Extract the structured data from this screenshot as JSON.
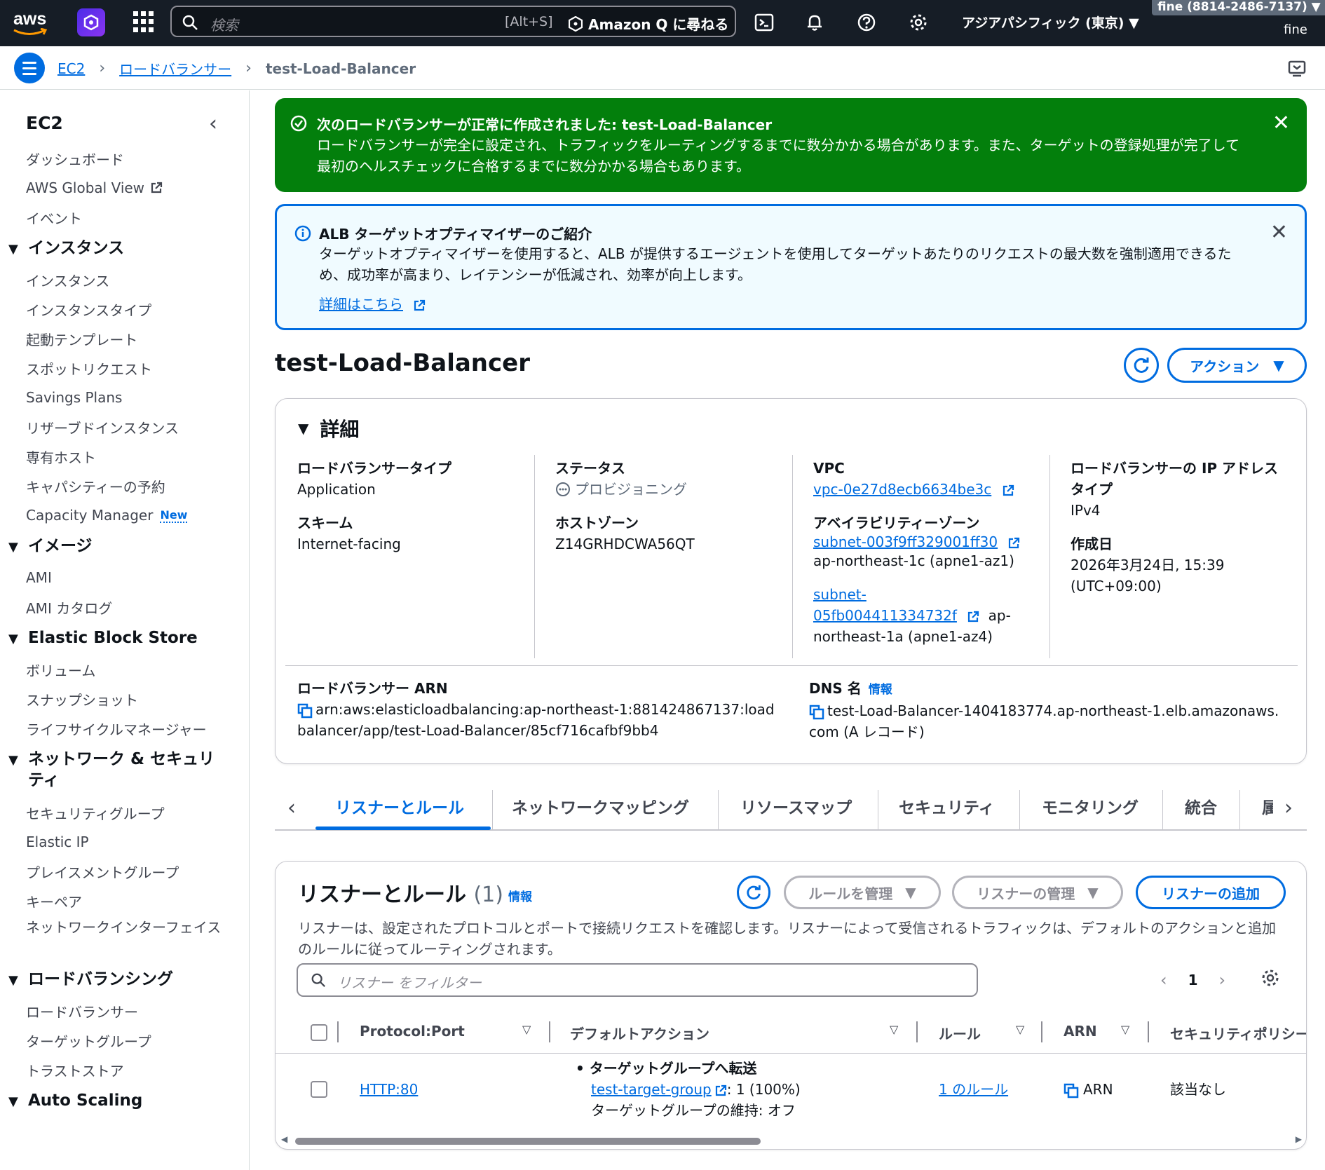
{
  "topnav": {
    "logo_text": "aws",
    "search_placeholder": "検索",
    "search_shortcut": "[Alt+S]",
    "amazon_q_label": "Amazon Q に尋ねる",
    "region": "アジアパシフィック (東京)",
    "account": "fine (8814-2486-7137)",
    "user": "fine"
  },
  "breadcrumb": {
    "items": [
      "EC2",
      "ロードバランサー"
    ],
    "current": "test-Load-Balancer"
  },
  "sidebar": {
    "title": "EC2",
    "top_items": [
      "ダッシュボード",
      "AWS Global View",
      "イベント"
    ],
    "sections": [
      {
        "title": "インスタンス",
        "items": [
          "インスタンス",
          "インスタンスタイプ",
          "起動テンプレート",
          "スポットリクエスト",
          "Savings Plans",
          "リザーブドインスタンス",
          "専有ホスト",
          "キャパシティーの予約",
          "Capacity Manager"
        ]
      },
      {
        "title": "イメージ",
        "items": [
          "AMI",
          "AMI カタログ"
        ]
      },
      {
        "title": "Elastic Block Store",
        "items": [
          "ボリューム",
          "スナップショット",
          "ライフサイクルマネージャー"
        ]
      },
      {
        "title": "ネットワーク & セキュリティ",
        "items": [
          "セキュリティグループ",
          "Elastic IP",
          "プレイスメントグループ",
          "キーペア",
          "ネットワークインターフェイス"
        ]
      },
      {
        "title": "ロードバランシング",
        "items": [
          "ロードバランサー",
          "ターゲットグループ",
          "トラストストア"
        ]
      },
      {
        "title": "Auto Scaling",
        "items": []
      }
    ],
    "new_badge": "New"
  },
  "flash_success": {
    "header": "次のロードバランサーが正常に作成されました: test-Load-Balancer",
    "body": "ロードバランサーが完全に設定され、トラフィックをルーティングするまでに数分かかる場合があります。また、ターゲットの登録処理が完了して最初のヘルスチェックに合格するまでに数分かかる場合もあります。"
  },
  "flash_info": {
    "header": "ALB ターゲットオプティマイザーのご紹介",
    "body": "ターゲットオプティマイザーを使用すると、ALB が提供するエージェントを使用してターゲットあたりのリクエストの最大数を強制適用できるため、成功率が高まり、レイテンシーが低減され、効率が向上します。",
    "link": "詳細はこちら"
  },
  "page": {
    "title": "test-Load-Balancer",
    "action_label": "アクション"
  },
  "details": {
    "section_title": "詳細",
    "lb_type_label": "ロードバランサータイプ",
    "lb_type_value": "Application",
    "scheme_label": "スキーム",
    "scheme_value": "Internet-facing",
    "status_label": "ステータス",
    "status_value": "プロビジョニング",
    "hosted_zone_label": "ホストゾーン",
    "hosted_zone_value": "Z14GRHDCWA56QT",
    "vpc_label": "VPC",
    "vpc_value": "vpc-0e27d8ecb6634be3c",
    "az_label": "アベイラビリティーゾーン",
    "az1_subnet": "subnet-003f9ff329001ff30",
    "az1_zone": "ap-northeast-1c (apne1-az1)",
    "az2_subnet_a": "subnet-",
    "az2_subnet_b": "05fb004411334732f",
    "az2_zone_a": "ap-",
    "az2_zone_b": "northeast-1a (apne1-az4)",
    "ip_type_label_1": "ロードバランサーの IP アドレス",
    "ip_type_label_2": "タイプ",
    "ip_type_value": "IPv4",
    "created_label": "作成日",
    "created_value_1": "2026年3月24日, 15:39",
    "created_value_2": "(UTC+09:00)",
    "arn_label": "ロードバランサー ARN",
    "arn_value": "arn:aws:elasticloadbalancing:ap-northeast-1:881424867137:loadbalancer/app/test-Load-Balancer/85cf716cafbf9bb4",
    "dns_label": "DNS 名",
    "dns_info": "情報",
    "dns_value": "test-Load-Balancer-1404183774.ap-northeast-1.elb.amazonaws.com (A レコード)"
  },
  "tabs": [
    "リスナーとルール",
    "ネットワークマッピング",
    "リソースマップ",
    "セキュリティ",
    "モニタリング",
    "統合",
    "属"
  ],
  "listeners": {
    "title": "リスナーとルール",
    "count": "(1)",
    "info": "情報",
    "manage_rules": "ルールを管理",
    "manage_listeners": "リスナーの管理",
    "add_listener": "リスナーの追加",
    "description": "リスナーは、設定されたプロトコルとポートで接続リクエストを確認します。リスナーによって受信されるトラフィックは、デフォルトのアクションと追加のルールに従ってルーティングされます。",
    "filter_placeholder": "リスナー をフィルター",
    "page": "1",
    "columns": [
      "Protocol:Port",
      "デフォルトアクション",
      "ルール",
      "ARN",
      "セキュリティポリシー"
    ],
    "rows": [
      {
        "protocol_port": "HTTP:80",
        "action_title": "ターゲットグループへ転送",
        "target_group": "test-target-group",
        "weight": ": 1 (100%)",
        "stickiness": "ターゲットグループの維持: オフ",
        "rules": "1 のルール",
        "arn": "ARN",
        "security_policy": "該当なし"
      }
    ]
  }
}
